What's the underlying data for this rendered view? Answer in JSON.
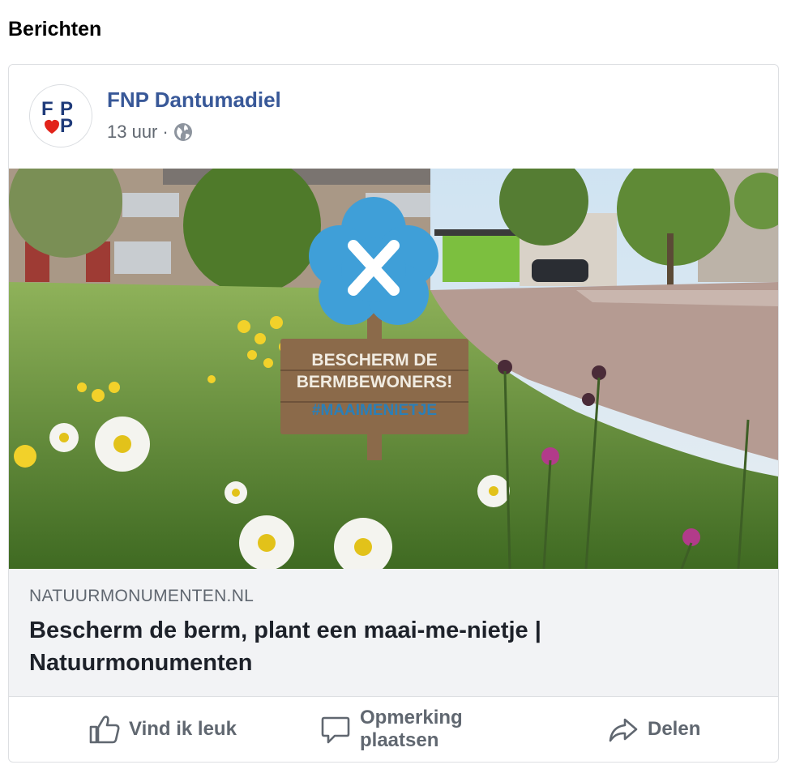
{
  "section": {
    "title": "Berichten"
  },
  "post": {
    "page_name": "FNP Dantumadiel",
    "avatar_text": "FNP",
    "time": "13 uur",
    "separator": "·",
    "privacy_icon": "globe-icon"
  },
  "image": {
    "sign_line1": "BESCHERM DE",
    "sign_line2": "BERMBEWONERS!",
    "sign_line3": "#MAAIMENIETJE",
    "colors": {
      "flower": "#3f9fd8",
      "grass": "#5f8f32",
      "sign": "#8b6a4a"
    }
  },
  "link": {
    "domain": "NATUURMONUMENTEN.NL",
    "title": "Bescherm de berm, plant een maai-me-nietje | Natuurmonumenten"
  },
  "actions": {
    "like": {
      "label": "Vind ik leuk",
      "icon": "thumbs-up-icon"
    },
    "comment": {
      "label_line1": "Opmerking",
      "label_line2": "plaatsen",
      "icon": "comment-icon"
    },
    "share": {
      "label": "Delen",
      "icon": "share-icon"
    }
  }
}
